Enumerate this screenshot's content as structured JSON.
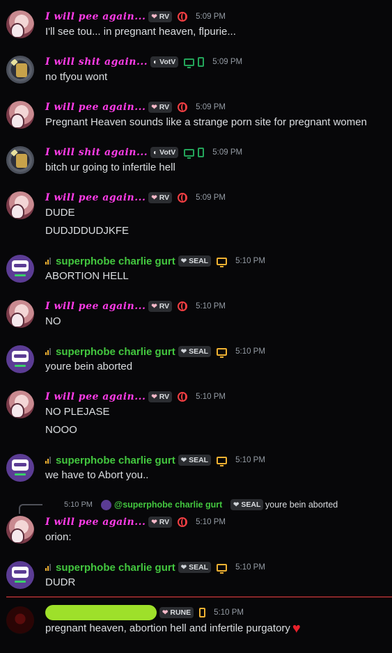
{
  "users": {
    "pee": {
      "name": "I will pee again...",
      "tag": "RV"
    },
    "shit": {
      "name": "I will shit again...",
      "tag": "VotV"
    },
    "charlie": {
      "name": "superphobe charlie gurt",
      "tag": "SEAL"
    },
    "rune": {
      "tag": "RUNE"
    }
  },
  "messages": [
    {
      "time": "5:09 PM",
      "lines": [
        "I'll see tou... in pregnant heaven, flpurie..."
      ]
    },
    {
      "time": "5:09 PM",
      "lines": [
        "no tfyou wont"
      ]
    },
    {
      "time": "5:09 PM",
      "lines": [
        "Pregnant Heaven sounds like a strange porn site for pregnant women"
      ]
    },
    {
      "time": "5:09 PM",
      "lines": [
        "bitch ur going to infertile hell"
      ]
    },
    {
      "time": "5:09 PM",
      "lines": [
        "DUDE",
        "DUDJDDUDJKFE"
      ]
    },
    {
      "time": "5:10 PM",
      "lines": [
        "ABORTION HELL"
      ]
    },
    {
      "time": "5:10 PM",
      "lines": [
        "NO"
      ]
    },
    {
      "time": "5:10 PM",
      "lines": [
        "youre bein aborted"
      ]
    },
    {
      "time": "5:10 PM",
      "lines": [
        "NO PLEJASE",
        "NOOO"
      ]
    },
    {
      "time": "5:10 PM",
      "lines": [
        "we have to Abort you.."
      ]
    },
    {
      "time": "5:10 PM",
      "lines": [
        "orion:"
      ]
    },
    {
      "time": "5:10 PM",
      "lines": [
        "DUDR"
      ]
    },
    {
      "time": "5:10 PM",
      "lines": [
        "pregnant heaven, abortion hell and infertile purgatory"
      ]
    }
  ],
  "reply": {
    "time": "5:10 PM",
    "name": "@superphobe charlie gurt",
    "tag": "SEAL",
    "text": "youre bein aborted"
  },
  "colors": {
    "pee_name": "#ff3ce8",
    "charlie_name": "#43c73f",
    "new_messages_divider": "#f23f43",
    "redaction": "#9ee02a"
  }
}
